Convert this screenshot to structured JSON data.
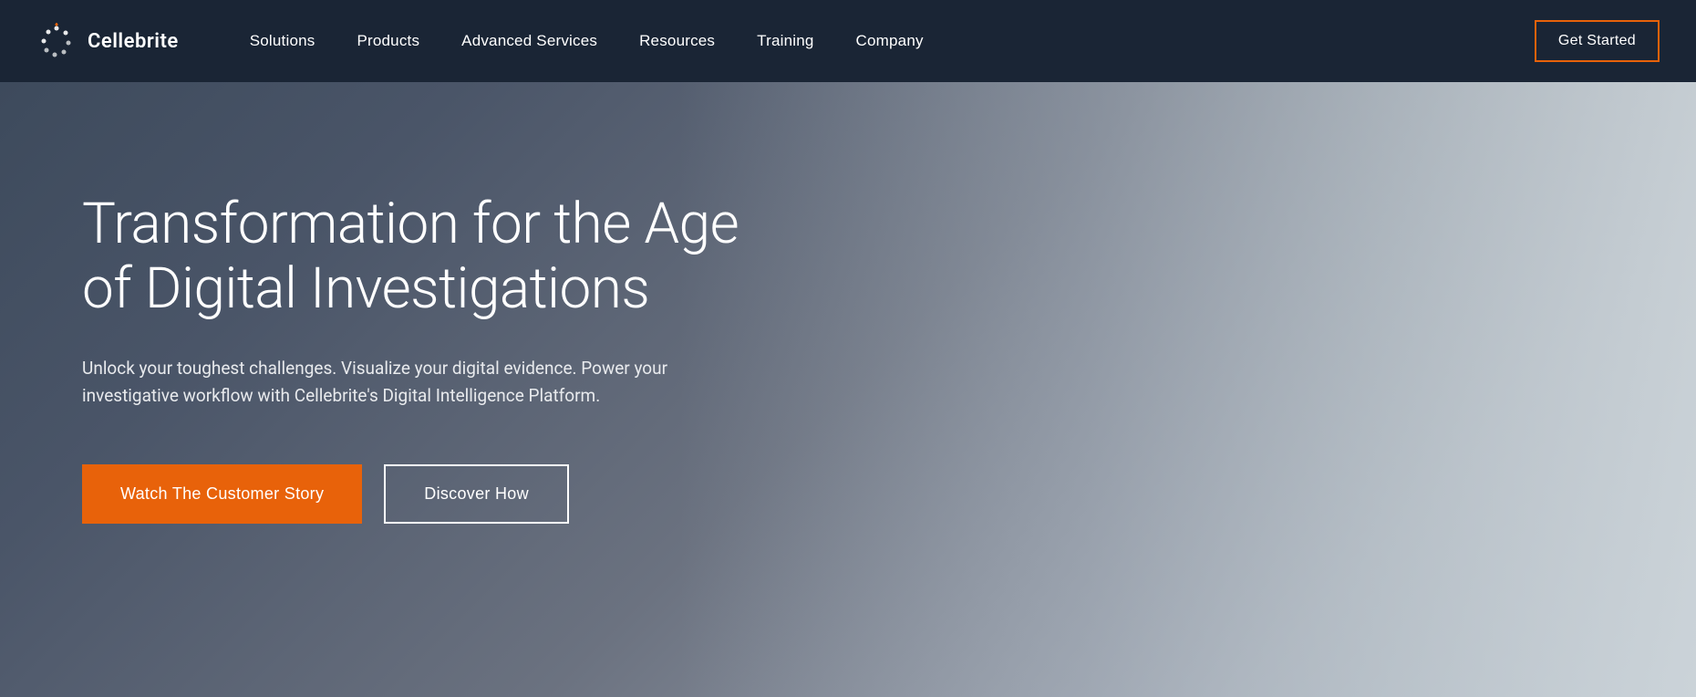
{
  "navbar": {
    "logo_text": "Cellebrite",
    "nav_items": [
      {
        "label": "Solutions",
        "id": "solutions"
      },
      {
        "label": "Products",
        "id": "products"
      },
      {
        "label": "Advanced Services",
        "id": "advanced-services"
      },
      {
        "label": "Resources",
        "id": "resources"
      },
      {
        "label": "Training",
        "id": "training"
      },
      {
        "label": "Company",
        "id": "company"
      }
    ],
    "cta_label": "Get Started"
  },
  "hero": {
    "title": "Transformation for the Age of Digital Investigations",
    "subtitle": "Unlock your toughest challenges. Visualize your digital evidence. Power your investigative workflow with Cellebrite's Digital Intelligence Platform.",
    "btn_primary": "Watch The Customer Story",
    "btn_secondary": "Discover How"
  }
}
